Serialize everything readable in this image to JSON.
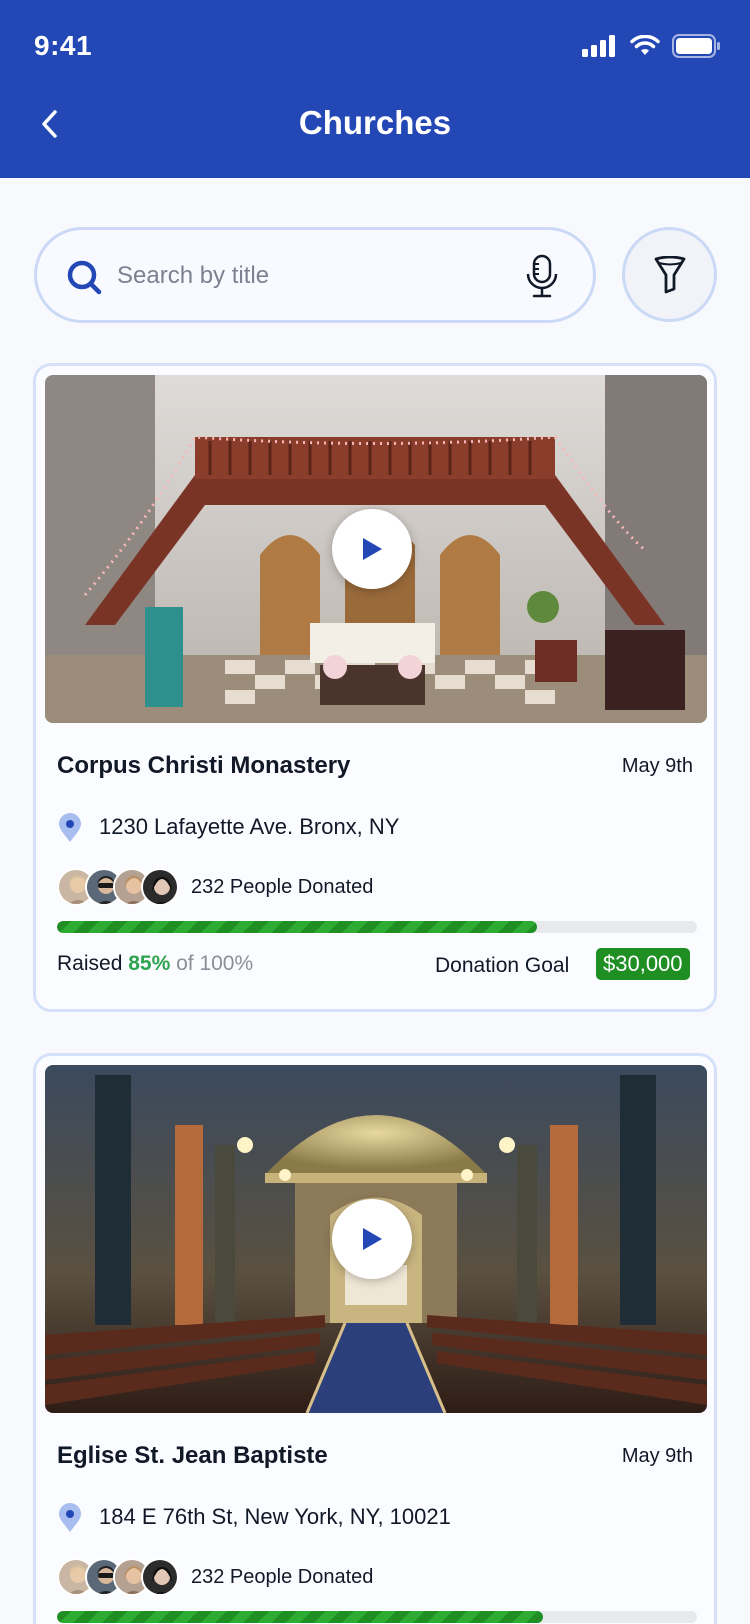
{
  "status_bar": {
    "time": "9:41"
  },
  "header": {
    "title": "Churches"
  },
  "search": {
    "placeholder": "Search by title"
  },
  "cards": [
    {
      "name": "Corpus Christi Monastery",
      "date": "May 9th",
      "address": "1230 Lafayette Ave. Bronx, NY",
      "donors_text": "232 People Donated",
      "progress": 0.75,
      "raised_label": "Raised",
      "raised_pct": "85%",
      "raised_of": "of 100%",
      "goal_label": "Donation Goal",
      "goal_amount": "$30,000"
    },
    {
      "name": "Eglise St. Jean Baptiste",
      "date": "May 9th",
      "address": "184 E 76th St, New York, NY, 10021",
      "donors_text": "232 People Donated",
      "progress": 0.76
    }
  ],
  "colors": {
    "header_bg": "#2348b6",
    "accent_green": "#2ea44f",
    "goal_badge_bg": "#1f8f24",
    "card_border": "#d5e1f8"
  }
}
